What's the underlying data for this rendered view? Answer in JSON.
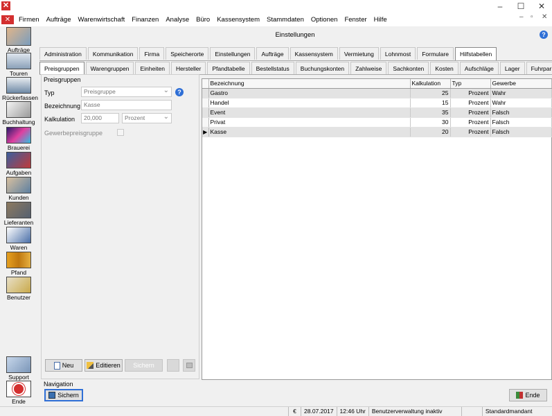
{
  "window": {
    "minimize": "–",
    "maximize": "☐",
    "close": "✕",
    "app_icon": "✕"
  },
  "menu": {
    "items": [
      "Firmen",
      "Aufträge",
      "Warenwirtschaft",
      "Finanzen",
      "Analyse",
      "Büro",
      "Kassensystem",
      "Stammdaten",
      "Optionen",
      "Fenster",
      "Hilfe"
    ],
    "child_controls": {
      "minimize": "–",
      "restore": "▫",
      "close": "✕"
    }
  },
  "sidebar": {
    "items": [
      {
        "label": "Aufträge",
        "icon": "orders-icon"
      },
      {
        "label": "Touren",
        "icon": "truck-icon"
      },
      {
        "label": "Rückerfassen",
        "icon": "return-truck-icon"
      },
      {
        "label": "Buchhaltung",
        "icon": "ledger-icon"
      },
      {
        "label": "Brauerei",
        "icon": "brewery-icon"
      },
      {
        "label": "Aufgaben",
        "icon": "tasks-icon"
      },
      {
        "label": "Kunden",
        "icon": "customers-icon"
      },
      {
        "label": "Lieferanten",
        "icon": "suppliers-icon"
      },
      {
        "label": "Waren",
        "icon": "goods-icon"
      },
      {
        "label": "Pfand",
        "icon": "deposit-icon"
      },
      {
        "label": "Benutzer",
        "icon": "user-lock-icon"
      }
    ],
    "bottom": [
      {
        "label": "Support",
        "icon": "handshake-icon"
      },
      {
        "label": "Ende",
        "icon": "power-icon"
      }
    ]
  },
  "header": {
    "title": "Einstellungen",
    "help": "?"
  },
  "tabs_top": [
    "Administration",
    "Kommunikation",
    "Firma",
    "Speicherorte",
    "Einstellungen",
    "Aufträge",
    "Kassensystem",
    "Vermietung",
    "Lohnmost",
    "Formulare",
    "Hilfstabellen"
  ],
  "tabs_top_selected": 10,
  "tabs_sub": [
    "Preisgruppen",
    "Warengruppen",
    "Einheiten",
    "Hersteller",
    "Pfandtabelle",
    "Bestellstatus",
    "Buchungskonten",
    "Zahlweise",
    "Sachkonten",
    "Kosten",
    "Aufschläge",
    "Lager",
    "Fuhrpark"
  ],
  "tabs_sub_selected": 0,
  "form": {
    "group_title": "Preisgruppen",
    "typ_label": "Typ",
    "typ_value": "Preisgruppe",
    "bezeichnung_label": "Bezeichnung",
    "bezeichnung_value": "Kasse",
    "kalkulation_label": "Kalkulation",
    "kalkulation_value": "20,000",
    "kalkulation_unit": "Prozent",
    "gewerbe_label": "Gewerbepreisgruppe",
    "gewerbe_checked": false,
    "info": "?"
  },
  "form_buttons": {
    "neu": "Neu",
    "editieren": "Editieren",
    "sichern": "Sichern"
  },
  "grid": {
    "columns": [
      "Bezeichnung",
      "Kalkulation",
      "Typ",
      "Gewerbe"
    ],
    "rows": [
      {
        "bezeichnung": "Gastro",
        "kalkulation": "25",
        "typ": "Prozent",
        "gewerbe": "Wahr"
      },
      {
        "bezeichnung": "Handel",
        "kalkulation": "15",
        "typ": "Prozent",
        "gewerbe": "Wahr"
      },
      {
        "bezeichnung": "Event",
        "kalkulation": "35",
        "typ": "Prozent",
        "gewerbe": "Falsch"
      },
      {
        "bezeichnung": "Privat",
        "kalkulation": "30",
        "typ": "Prozent",
        "gewerbe": "Falsch"
      },
      {
        "bezeichnung": "Kasse",
        "kalkulation": "20",
        "typ": "Prozent",
        "gewerbe": "Falsch"
      }
    ],
    "current_row": 4
  },
  "navigation": {
    "title": "Navigation",
    "save": "Sichern",
    "end": "Ende"
  },
  "status": {
    "currency": "€",
    "date": "28.07.2017",
    "time": "12:46 Uhr",
    "info": "Benutzerverwaltung inaktiv",
    "mandant": "Standardmandant"
  },
  "colors": {
    "accent": "#d32f2f",
    "help_blue": "#2f6fd6",
    "row_alt": "#e3e3e3"
  }
}
